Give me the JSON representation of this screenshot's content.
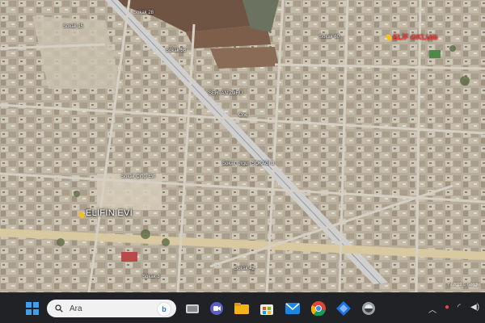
{
  "map": {
    "labels": {
      "elif_evi": "ELİFİN EVİ",
      "elif_oklu": "ELİF OKLUib",
      "street_1": "Sokak 56",
      "street_2": "ŞERTAN ZÜRÜ",
      "street_3": "One",
      "street_4": "Sokak Urgun SOKAĞI 3",
      "street_5": "Sokak Çiftçi Evi",
      "street_6": "Sokak 28",
      "street_7": "Sokak 15",
      "street_8": "Sokak 3",
      "street_9": "Sokak 60",
      "street_10": "Sokak 42"
    },
    "credit": "Yıl 2023 © Google"
  },
  "taskbar": {
    "search_placeholder": "Ara",
    "search_badge": "b",
    "apps": [
      "start-icon",
      "widgets-icon",
      "meet-icon",
      "file-explorer-icon",
      "store-icon",
      "mail-icon",
      "chrome-icon",
      "app-blue-icon",
      "app-round-icon"
    ],
    "tray": [
      "chevron-up-icon",
      "security-icon",
      "network-icon",
      "volume-icon"
    ]
  },
  "colors": {
    "taskbar_bg": "#202226",
    "search_bg": "#f1f1f1",
    "pin_yellow": "#f2c21b",
    "pin_red": "#ff3b30"
  }
}
